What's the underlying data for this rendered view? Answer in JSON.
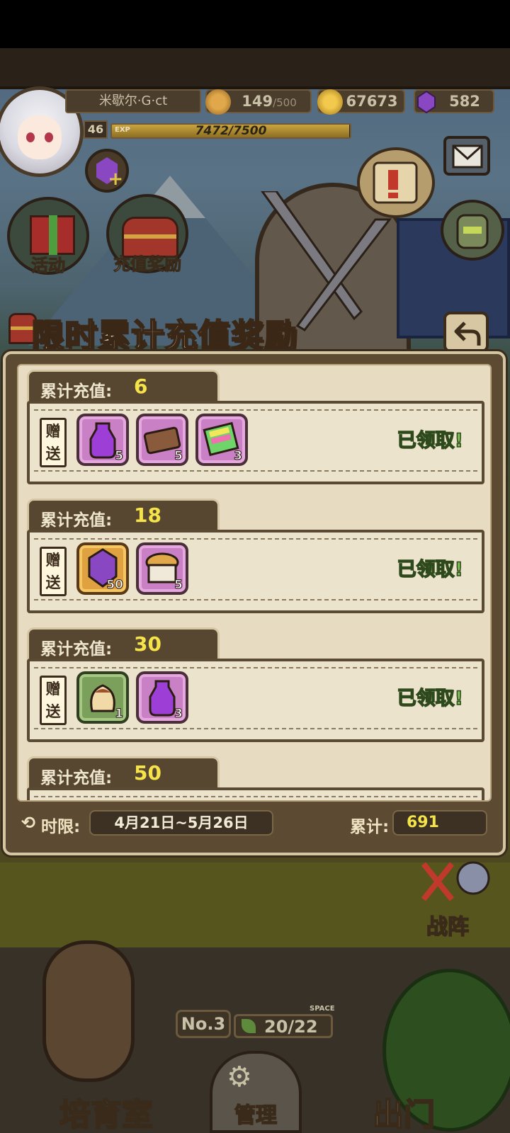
{
  "hud": {
    "player_name": "米歇尔·G·ct",
    "level": "46",
    "exp_label": "EXP",
    "exp_text": "7472/7500",
    "exp_progress": 0.996,
    "bread_value": "149",
    "bread_max": "/500",
    "gold_value": "67673",
    "gem_value": "582",
    "activity_label": "活动",
    "recharge_reward_label": "充值奖励"
  },
  "dialog": {
    "title": "限时累计充值奖励",
    "tiers": [
      {
        "label": "累计充值:",
        "value": "6",
        "gift_tag": "赠送",
        "items": [
          {
            "icon": "purple-potion-icon",
            "rarity": "purple",
            "count": "5"
          },
          {
            "icon": "ticket-icon",
            "rarity": "purple",
            "count": "5"
          },
          {
            "icon": "rainbow-book-icon",
            "rarity": "purple",
            "count": "3"
          }
        ],
        "status": "已领取!"
      },
      {
        "label": "累计充值:",
        "value": "18",
        "gift_tag": "赠送",
        "items": [
          {
            "icon": "purple-gem-icon",
            "rarity": "orange",
            "count": "50"
          },
          {
            "icon": "bread-basket-icon",
            "rarity": "purple",
            "count": "5"
          }
        ],
        "status": "已领取!"
      },
      {
        "label": "累计充值:",
        "value": "30",
        "gift_tag": "赠送",
        "items": [
          {
            "icon": "pudding-icon",
            "rarity": "green",
            "count": "1"
          },
          {
            "icon": "purple-potion-icon",
            "rarity": "purple",
            "count": "3"
          }
        ],
        "status": "已领取!"
      },
      {
        "label": "累计充值:",
        "value": "50"
      }
    ],
    "footer": {
      "limit_label": "时限:",
      "date_range": "4月21日~5月26日",
      "total_label": "累计:",
      "total_value": "691"
    }
  },
  "bottom": {
    "battle_label": "战阵",
    "no_label": "No.3",
    "space_tag": "SPACE",
    "space_value": "20/22",
    "nav": {
      "nursery": "培育室",
      "manage": "管理",
      "go_out": "出门"
    }
  },
  "colors": {
    "accent_yellow": "#f5e34a",
    "claimed_green": "#7fbf55",
    "panel_brown": "#5c4a33",
    "parchment": "#e7dcc2"
  }
}
